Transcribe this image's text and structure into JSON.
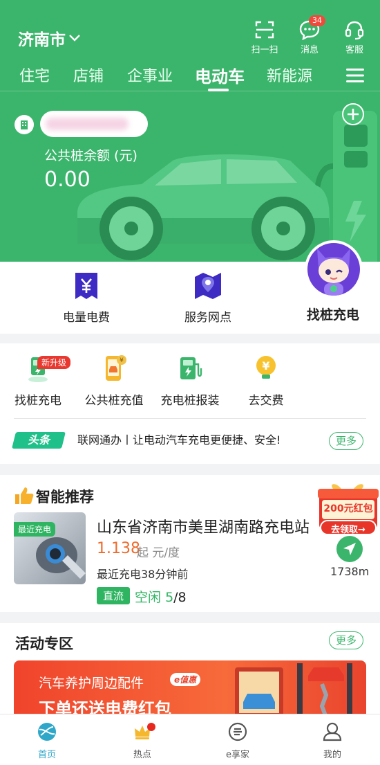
{
  "header": {
    "city": "济南市",
    "top_icons": [
      {
        "name": "scan",
        "label": "扫一扫"
      },
      {
        "name": "messages",
        "label": "消息",
        "badge": "34"
      },
      {
        "name": "service",
        "label": "客服"
      }
    ],
    "tabs": [
      "住宅",
      "店铺",
      "企事业",
      "电动车",
      "新能源"
    ],
    "active_tab": "电动车"
  },
  "account": {
    "balance_label": "公共桩余额 (元)",
    "balance_value": "0.00"
  },
  "quick_actions": [
    {
      "label": "电量电费",
      "icon": "yen-receipt-icon"
    },
    {
      "label": "服务网点",
      "icon": "map-pin-icon"
    },
    {
      "label": "找桩充电",
      "icon": "mascot-avatar"
    }
  ],
  "services": [
    {
      "label": "找桩充电",
      "tag": "新升级"
    },
    {
      "label": "公共桩充值"
    },
    {
      "label": "充电桩报装"
    },
    {
      "label": "去交费"
    }
  ],
  "news": {
    "tag": "头条",
    "text": "联网通办丨让电动汽车充电更便捷、安全!",
    "more": "更多"
  },
  "recommend": {
    "title": "智能推荐",
    "recent_tag": "最近充电",
    "station_name": "山东省济南市美里湖南路充电站",
    "price": "1.138",
    "price_unit": "起 元/度",
    "last_charge": "最近充电38分钟前",
    "type_tag": "直流",
    "idle_label": "空闲",
    "idle_count": "5",
    "total": "/8",
    "distance": "1738m",
    "promo_amount": "200元红包",
    "promo_action": "去领取→"
  },
  "activity": {
    "title": "活动专区",
    "more": "更多",
    "banner_line1": "汽车养护周边配件",
    "banner_badge": "e值惠",
    "banner_line2": "下单还送电费红包"
  },
  "bottom_nav": [
    {
      "label": "首页",
      "active": true
    },
    {
      "label": "热点"
    },
    {
      "label": "e享家"
    },
    {
      "label": "我的"
    }
  ],
  "colors": {
    "primary_green": "#3cb56c",
    "accent_orange": "#f06a2a",
    "badge_red": "#f04a3c"
  }
}
